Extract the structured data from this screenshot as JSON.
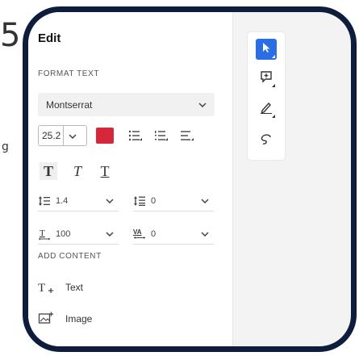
{
  "background": {
    "fragment_number": "5",
    "fragment_letter": "g"
  },
  "panel": {
    "title": "Edit",
    "format_section_label": "FORMAT TEXT",
    "font_family": "Montserrat",
    "font_size": "25.2",
    "text_color": "#d6263a",
    "line_spacing": "1.4",
    "paragraph_spacing": "0",
    "char_scale": "100",
    "char_spacing": "0",
    "char_spacing_icon_label": "VA",
    "add_section_label": "ADD CONTENT",
    "add_items": [
      {
        "label": "Text",
        "icon": "add-text-icon"
      },
      {
        "label": "Image",
        "icon": "add-image-icon"
      }
    ],
    "style_glyphs": {
      "bold": "T",
      "italic": "T",
      "underline": "T"
    }
  },
  "toolbar": {
    "tools": [
      "select-arrow-icon",
      "add-comment-icon",
      "pen-icon",
      "lasso-icon"
    ],
    "active_color": "#2a6ee6"
  }
}
